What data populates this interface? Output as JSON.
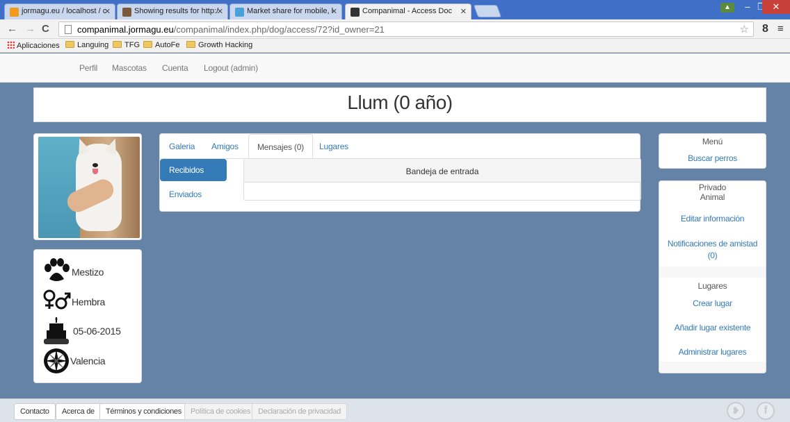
{
  "browser": {
    "tabs": [
      {
        "title": "jormagu.eu / localhost / c",
        "favicon_color": "#f29a1c"
      },
      {
        "title": "Showing results for http:/",
        "favicon_color": "#7a5a3a"
      },
      {
        "title": "Market share for mobile, l",
        "favicon_color": "#4aa0d8"
      },
      {
        "title": "Companimal - Access Doc",
        "favicon_color": "#333333"
      }
    ],
    "address": {
      "host": "companimal.jormagu.eu",
      "path": "/companimal/index.php/dog/access/72?id_owner=21"
    },
    "bookmarks": [
      {
        "label": "Aplicaciones",
        "icon": "apps-icon"
      },
      {
        "label": "Languing",
        "icon": "folder-icon"
      },
      {
        "label": "TFG",
        "icon": "folder-icon"
      },
      {
        "label": "AutoFe",
        "icon": "folder-icon"
      },
      {
        "label": "Growth Hacking",
        "icon": "folder-icon"
      }
    ]
  },
  "nav": {
    "items": [
      {
        "label": "Perfil"
      },
      {
        "label": "Mascotas"
      },
      {
        "label": "Cuenta"
      },
      {
        "label": "Logout (admin)"
      }
    ]
  },
  "page": {
    "title": "Llum (0 año)"
  },
  "dog_info": {
    "breed": "Mestizo",
    "sex": "Hembra",
    "birthdate": "05-06-2015",
    "location": "Valencia"
  },
  "profile_tabs": [
    {
      "label": "Galeria"
    },
    {
      "label": "Amigos"
    },
    {
      "label": "Mensajes (0)"
    },
    {
      "label": "Lugares"
    }
  ],
  "messages": {
    "folders": [
      {
        "label": "Recibidos"
      },
      {
        "label": "Enviados"
      }
    ],
    "inbox_title": "Bandeja de entrada"
  },
  "sidebar": {
    "menu": {
      "title": "Menú",
      "links": [
        {
          "label": "Buscar perros"
        }
      ]
    },
    "private": {
      "title": "Privado",
      "animal_title": "Animal",
      "animal_links": [
        {
          "label": "Editar información"
        },
        {
          "label": "Notificaciones de amistad (0)"
        }
      ],
      "places_title": "Lugares",
      "places_links": [
        {
          "label": "Crear lugar"
        },
        {
          "label": "Añadir lugar existente"
        },
        {
          "label": "Administrar lugares"
        }
      ]
    }
  },
  "footer": {
    "buttons": [
      {
        "label": "Contacto"
      },
      {
        "label": "Acerca de"
      },
      {
        "label": "Términos y condiciones"
      },
      {
        "label": "Política de cookies"
      },
      {
        "label": "Declaración de privacidad"
      }
    ],
    "social": [
      {
        "label": "twitter-icon"
      },
      {
        "label": "facebook-icon"
      }
    ]
  },
  "colors": {
    "background": "#6483a6",
    "link": "#337ab7",
    "active_pill": "#337ab7"
  }
}
